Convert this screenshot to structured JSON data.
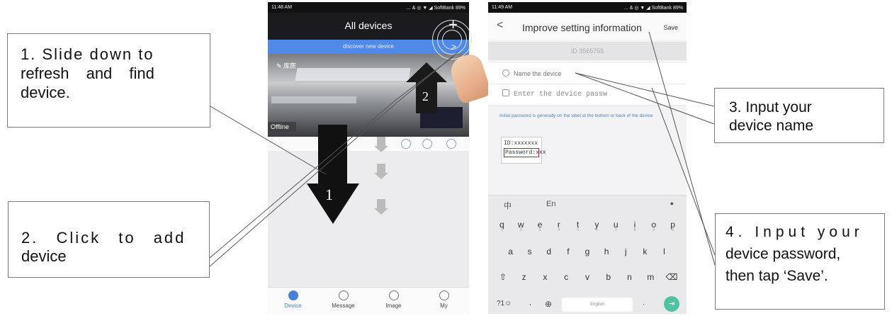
{
  "callouts": {
    "step1_line1": "1. Slide down to",
    "step1_line2": "refresh and find",
    "step1_line3": "device.",
    "step2_line1": "2. Click to add",
    "step2_line2": "device",
    "step3_line1": "3. Input your",
    "step3_line2": "device name",
    "step4_line1": "4. Input your",
    "step4_line2": "device password,",
    "step4_line3": "then tap ‘Save’."
  },
  "arrows": {
    "one": "1",
    "two": "2"
  },
  "phone1": {
    "status_time": "11:48 AM",
    "status_right": "… & ◎ ▼ ◢ SoftBank 89%",
    "title": "All devices",
    "plus": "+",
    "banner": "discover new device",
    "chevron": ">",
    "edit_label": "✎ 库房",
    "offline": "Offline",
    "nav": [
      "Device",
      "Message",
      "Image",
      "My"
    ]
  },
  "phone2": {
    "status_time": "11:49 AM",
    "status_right": "… & ◎ ▼ ◢ SoftBank 89%",
    "back": "<",
    "title": "Improve setting information",
    "save": "Save",
    "id": "ID 3565755",
    "name_placeholder": "Name the device",
    "password_placeholder": "Enter the device passw",
    "hint": "Initial password is generally on the label at the bottom or back of the device",
    "label_id": "ID:xxxxxxx",
    "label_password": "Password:xxx",
    "kb_lang_zh": "中",
    "kb_lang_en": "En",
    "kb_mic": "●",
    "row1": [
      "q",
      "w",
      "e",
      "r",
      "t",
      "y",
      "u",
      "i",
      "o",
      "p"
    ],
    "row1_sub": [
      "1",
      "2",
      "3",
      "4",
      "5",
      "6",
      "7",
      "8",
      "9",
      "0"
    ],
    "row2": [
      "a",
      "s",
      "d",
      "f",
      "g",
      "h",
      "j",
      "k",
      "l"
    ],
    "row3": [
      "⇧",
      "z",
      "x",
      "c",
      "v",
      "b",
      "n",
      "m",
      "⌫"
    ],
    "kb_num": "?1☺",
    "kb_comma": ",",
    "kb_globe": "⊕",
    "kb_space": "English",
    "kb_period": ".",
    "kb_enter": "⇥"
  },
  "colors": {
    "banner": "#4f8ae8",
    "accent": "#4a7fd6",
    "enter": "#4fc3a1"
  }
}
